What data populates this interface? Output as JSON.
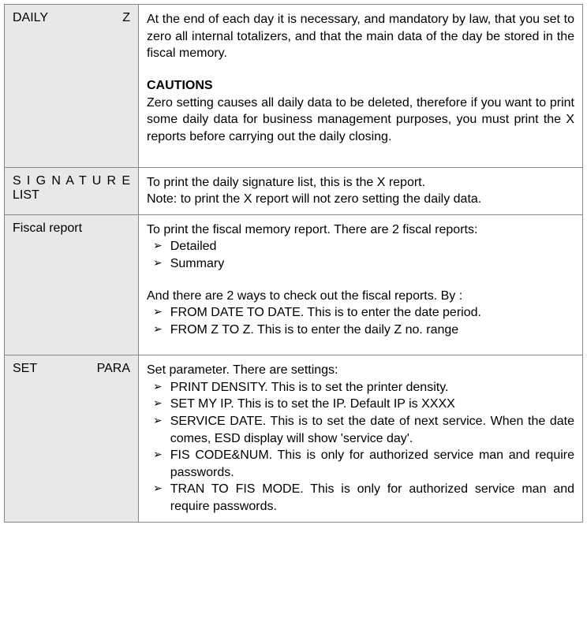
{
  "rows": {
    "daily_z": {
      "label": "DAILY Z",
      "para1": "At the end of each day it is necessary, and mandatory by law, that you set to zero all internal totalizers, and that the main data of the day be stored in the fiscal memory.",
      "cautions_title": "CAUTIONS",
      "cautions_body": "Zero setting causes all daily data to be deleted, therefore if you want to print some daily data for business management purposes, you must print the X reports before carrying out the daily closing."
    },
    "signature_list": {
      "label": "S I G N A T U R E LIST",
      "line1": "To print the daily signature list, this is the X report.",
      "line2": "Note: to print the X report will not zero setting the daily data."
    },
    "fiscal_report": {
      "label": "Fiscal report",
      "intro": "To print the fiscal memory report. There are 2 fiscal reports:",
      "bullets1": [
        "Detailed",
        "Summary"
      ],
      "mid": "And there are 2 ways to check out the fiscal reports. By :",
      "bullets2": [
        "FROM DATE TO DATE. This is to enter the date period.",
        "FROM Z TO Z. This is to enter the daily Z no. range"
      ]
    },
    "set_para": {
      "label": "SET PARA",
      "intro": "Set parameter. There are settings:",
      "bullets": [
        "PRINT DENSITY. This is to set the printer density.",
        "SET MY IP. This is to set the IP. Default IP is XXXX",
        "SERVICE DATE. This is to set the date of next service. When the date comes, ESD display will show 'service day'.",
        "FIS CODE&NUM. This is only for authorized service man and require passwords.",
        "TRAN TO FIS MODE. This is only for authorized service man and require passwords."
      ]
    }
  }
}
